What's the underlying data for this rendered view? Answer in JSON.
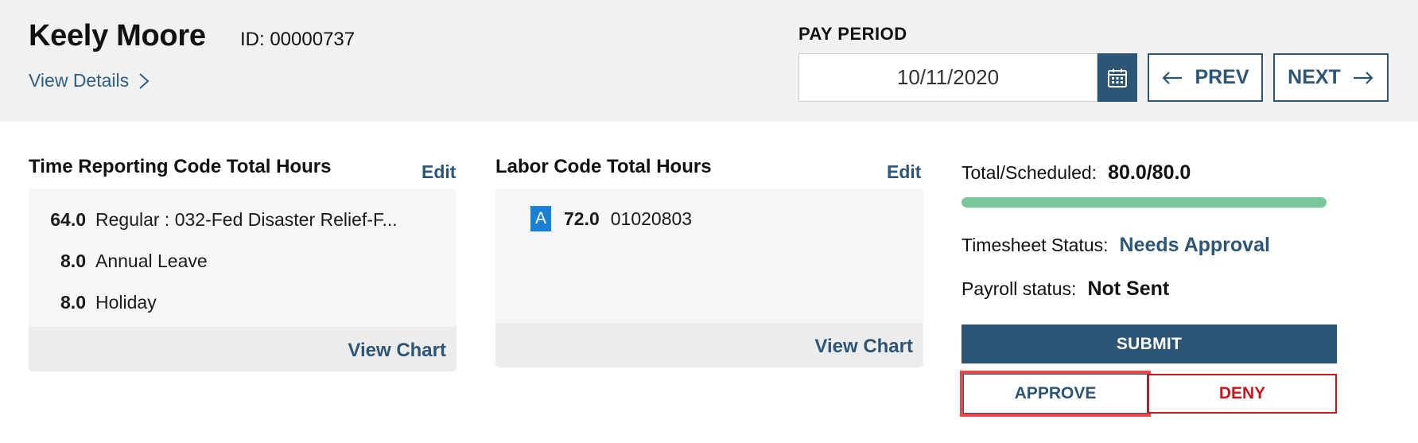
{
  "employee": {
    "name": "Keely Moore",
    "id_text": "ID: 00000737",
    "view_details_label": "View Details"
  },
  "pay_period": {
    "label": "PAY PERIOD",
    "date_value": "10/11/2020",
    "prev_label": "PREV",
    "next_label": "NEXT"
  },
  "trc": {
    "title": "Time Reporting Code Total Hours",
    "edit_label": "Edit",
    "rows": [
      {
        "hours": "64.0",
        "label": "Regular : 032-Fed Disaster Relief-F..."
      },
      {
        "hours": "8.0",
        "label": "Annual Leave"
      },
      {
        "hours": "8.0",
        "label": "Holiday"
      }
    ],
    "view_chart_label": "View Chart"
  },
  "labor": {
    "title": "Labor Code Total Hours",
    "edit_label": "Edit",
    "rows": [
      {
        "badge": "A",
        "hours": "72.0",
        "code": "01020803"
      }
    ],
    "view_chart_label": "View Chart"
  },
  "summary": {
    "total_label": "Total/Scheduled:",
    "total_value": "80.0/80.0",
    "progress_fraction": 1.0,
    "timesheet_label": "Timesheet Status:",
    "timesheet_value": "Needs Approval",
    "payroll_label": "Payroll status:",
    "payroll_value": "Not Sent"
  },
  "actions": {
    "submit_label": "SUBMIT",
    "approve_label": "APPROVE",
    "deny_label": "DENY"
  },
  "icons": {
    "view_details": "chevron-right-icon",
    "calendar": "calendar-icon",
    "prev": "arrow-left-icon",
    "next": "arrow-right-icon"
  },
  "colors": {
    "primary": "#2d5576",
    "progress": "#79c79a",
    "deny": "#c8161d",
    "badge": "#1b7fd4",
    "highlight": "#e8494a"
  }
}
